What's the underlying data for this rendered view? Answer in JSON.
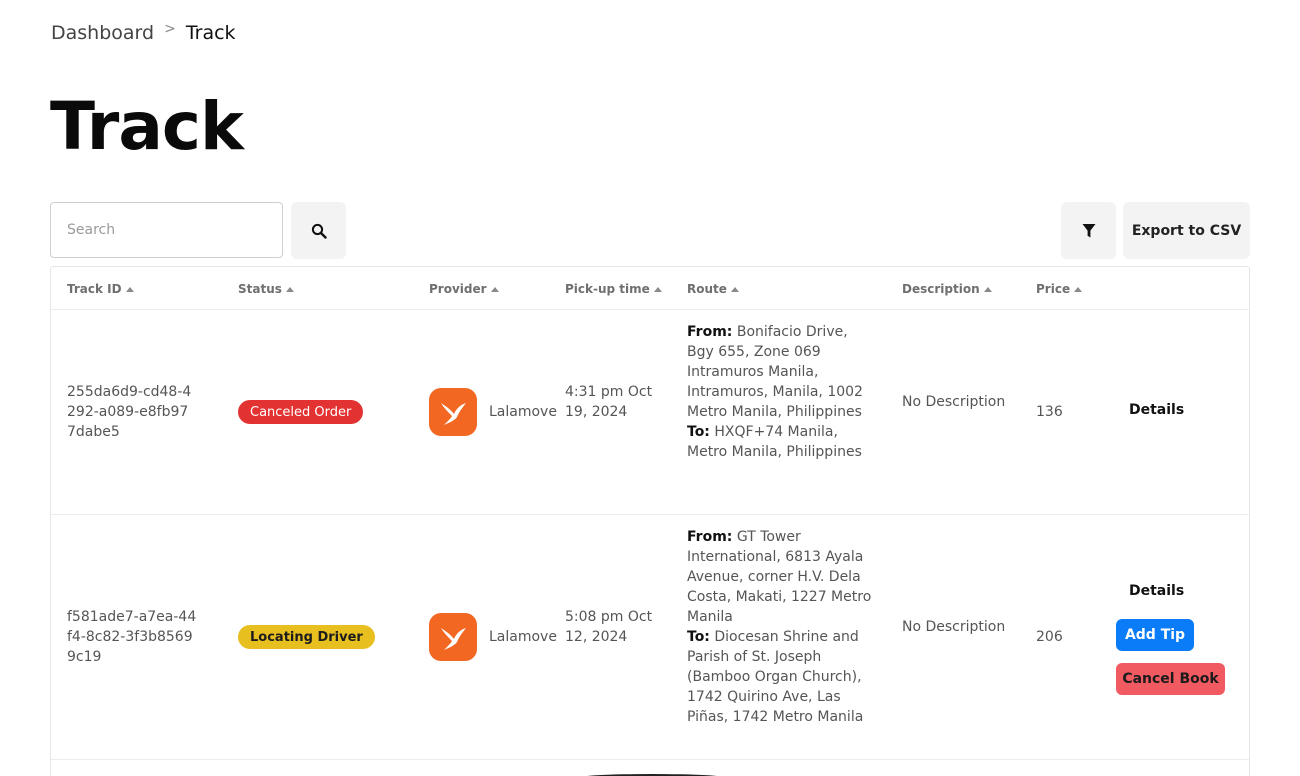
{
  "breadcrumb": {
    "parent": "Dashboard",
    "separator": ">",
    "current": "Track"
  },
  "page_title": "Track",
  "search": {
    "placeholder": "Search",
    "value": ""
  },
  "icons": {
    "search": "search-icon",
    "filter": "filter-icon",
    "sort": "sort-up-icon",
    "provider": "lalamove-logo-icon"
  },
  "toolbar": {
    "export_label": "Export to CSV"
  },
  "colors": {
    "canceled": "#e23232",
    "locating": "#e7bf1f",
    "lalamove": "#f26722",
    "add_tip": "#0b7cf7",
    "cancel_book": "#f25a62"
  },
  "table": {
    "columns": [
      "Track ID",
      "Status",
      "Provider",
      "Pick-up time",
      "Route",
      "Description",
      "Price"
    ],
    "rows": [
      {
        "track_id": "255da6d9-cd48-4292-a089-e8fb977dabe5",
        "status": "Canceled Order",
        "provider": "Lalamove",
        "pickup": "4:31 pm Oct 19, 2024",
        "route_from_label": "From:",
        "route_from": "Bonifacio Drive, Bgy 655, Zone 069 Intramuros Manila, Intramuros, Manila, 1002 Metro Manila, Philippines",
        "route_to_label": "To:",
        "route_to": "HXQF+74 Manila, Metro Manila, Philippines",
        "description": "No Description",
        "price": "136",
        "details_label": "Details"
      },
      {
        "track_id": "f581ade7-a7ea-44f4-8c82-3f3b85699c19",
        "status": "Locating Driver",
        "provider": "Lalamove",
        "pickup": "5:08 pm Oct 12, 2024",
        "route_from_label": "From:",
        "route_from": "GT Tower International, 6813 Ayala Avenue, corner H.V. Dela Costa, Makati, 1227 Metro Manila",
        "route_to_label": "To:",
        "route_to": "Diocesan Shrine and Parish of St. Joseph (Bamboo Organ Church), 1742 Quirino Ave, Las Piñas, 1742 Metro Manila",
        "description": "No Description",
        "price": "206",
        "details_label": "Details",
        "add_tip_label": "Add Tip",
        "cancel_label": "Cancel Book"
      }
    ]
  }
}
